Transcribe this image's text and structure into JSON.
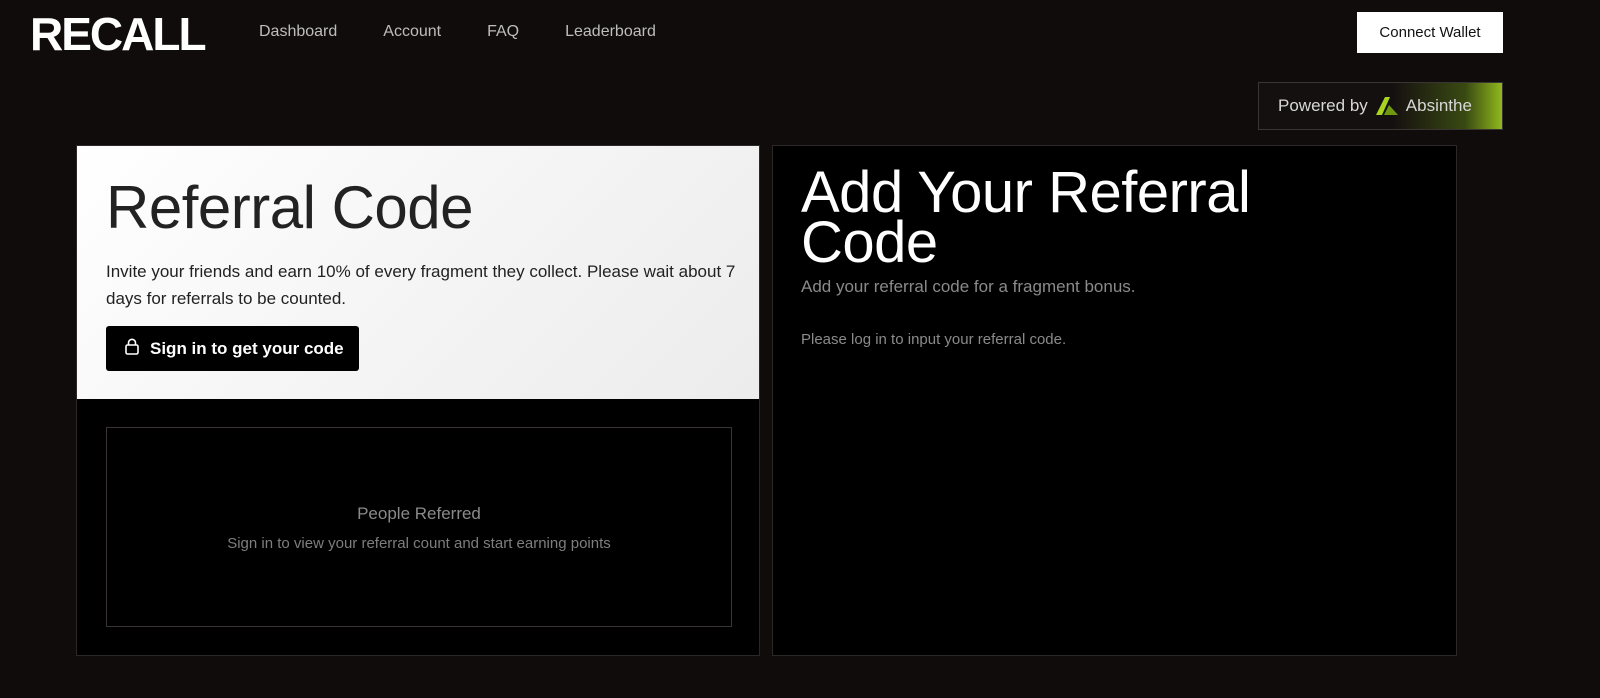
{
  "brand": {
    "logo_text": "RECALL"
  },
  "nav": {
    "items": [
      {
        "label": "Dashboard"
      },
      {
        "label": "Account"
      },
      {
        "label": "FAQ"
      },
      {
        "label": "Leaderboard"
      }
    ]
  },
  "header": {
    "connect_label": "Connect Wallet",
    "powered_prefix": "Powered by",
    "powered_brand": "Absinthe"
  },
  "referral": {
    "title": "Referral Code",
    "description": "Invite your friends and earn 10% of every fragment they collect. Please wait about 7 days for referrals to be counted.",
    "signin_label": "Sign in to get your code",
    "box_title": "People Referred",
    "box_subtitle": "Sign in to view your referral count and start earning points"
  },
  "add_referral": {
    "title": "Add Your Referral Code",
    "subtitle": "Add your referral code for a fragment bonus.",
    "note": "Please log in to input your referral code."
  },
  "colors": {
    "background": "#110c0c",
    "accent_green": "#90b81e",
    "card_bg": "#000000"
  }
}
